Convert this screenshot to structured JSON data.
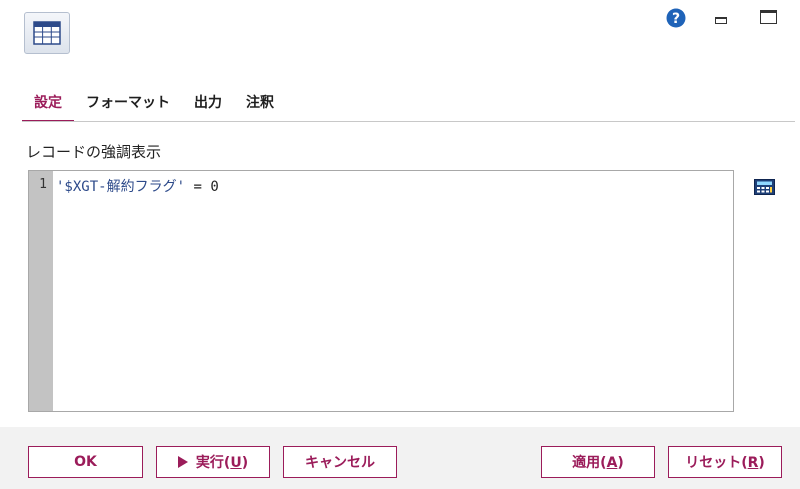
{
  "tabs": [
    {
      "label": "設定",
      "active": true
    },
    {
      "label": "フォーマット",
      "active": false
    },
    {
      "label": "出力",
      "active": false
    },
    {
      "label": "注釈",
      "active": false
    }
  ],
  "section_label": "レコードの強調表示",
  "editor": {
    "line_numbers": [
      "1"
    ],
    "code_string": "'$XGT-解約フラグ'",
    "code_operator": "=",
    "code_value": "0"
  },
  "buttons": {
    "ok": "OK",
    "run": {
      "text": "実行(",
      "mnemonic": "U",
      "close": ")"
    },
    "cancel": "キャンセル",
    "apply": {
      "text": "適用(",
      "mnemonic": "A",
      "close": ")"
    },
    "reset": {
      "text": "リセット(",
      "mnemonic": "R",
      "close": ")"
    }
  },
  "icons": {
    "app": "table-icon",
    "help": "help-icon",
    "minimize": "minimize-icon",
    "maximize": "maximize-icon",
    "calculator": "calculator-icon",
    "run": "play-icon"
  },
  "colors": {
    "accent": "#9b1c5a",
    "help_blue": "#1f63b8",
    "gutter": "#c3c3c3",
    "footer_bg": "#f2f2f2"
  }
}
